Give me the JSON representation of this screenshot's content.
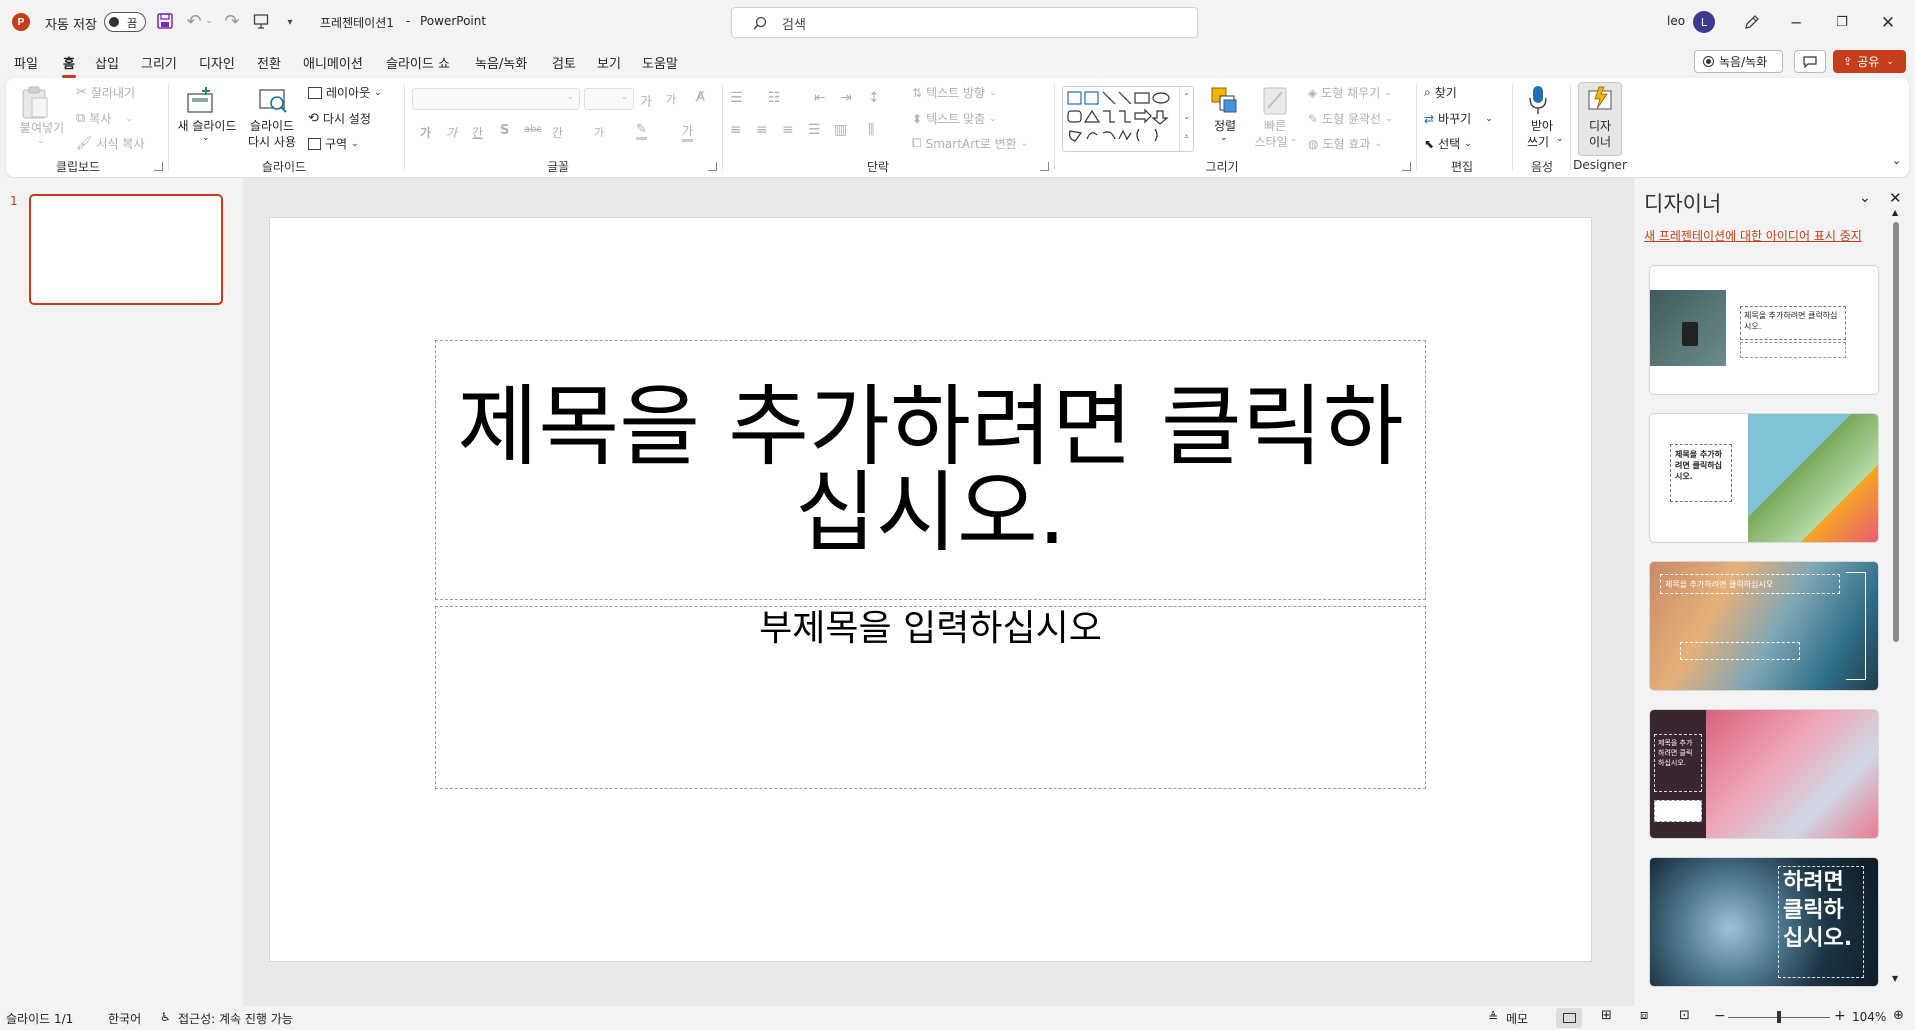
{
  "titlebar": {
    "autosave_label": "자동 저장",
    "autosave_state": "끔",
    "doc_title": "프레젠테이션1",
    "separator": "-",
    "app_name": "PowerPoint",
    "search_placeholder": "검색",
    "user_name": "leo",
    "avatar_initial": "L"
  },
  "tabs": [
    "파일",
    "홈",
    "삽입",
    "그리기",
    "디자인",
    "전환",
    "애니메이션",
    "슬라이드 쇼",
    "녹음/녹화",
    "검토",
    "보기",
    "도움말"
  ],
  "active_tab": "홈",
  "top_right": {
    "record_label": "녹음/녹화",
    "share_label": "공유"
  },
  "ribbon": {
    "clipboard": {
      "paste": "붙여넣기",
      "cut": "잘라내기",
      "copy": "복사",
      "format_painter": "서식 복사",
      "group": "클립보드"
    },
    "slides": {
      "new_slide": "새 슬라이드",
      "reuse_line1": "슬라이드",
      "reuse_line2": "다시 사용",
      "layout": "레이아웃",
      "reset": "다시 설정",
      "section": "구역",
      "group": "슬라이드"
    },
    "font": {
      "group": "글꼴",
      "grow": "가",
      "shrink": "가",
      "b": "가",
      "i": "가",
      "u": "간",
      "s": "S",
      "strike": "abc",
      "spacing": "간",
      "case": "가",
      "highlight": "가"
    },
    "paragraph": {
      "text_direction": "텍스트 방향",
      "align_text": "텍스트 맞춤",
      "smartart": "SmartArt로 변환",
      "group": "단락"
    },
    "drawing": {
      "arrange": "정렬",
      "quick_styles_line1": "빠른",
      "quick_styles_line2": "스타일",
      "fill": "도형 채우기",
      "outline": "도형 윤곽선",
      "effects": "도형 효과",
      "group": "그리기"
    },
    "editing": {
      "find": "찾기",
      "replace": "바꾸기",
      "select": "선택",
      "group": "편집"
    },
    "voice": {
      "dictate_line1": "받아",
      "dictate_line2": "쓰기",
      "group": "음성"
    },
    "designer": {
      "line1": "디자",
      "line2": "이너",
      "group": "Designer"
    }
  },
  "thumbnails": {
    "slide_number": "1"
  },
  "slide": {
    "title_placeholder": "제목을 추가하려면 클릭하십시오.",
    "subtitle_placeholder": "부제목을 입력하십시오"
  },
  "designer": {
    "title": "디자이너",
    "stop_link": "새 프레젠테이션에 대한 아이디어 표시 중지",
    "card1_text": "제목을 추가하려면 클릭하십시오.",
    "card2_text": "제목을 추가하려면 클릭하십시오.",
    "card3_text": "제목을 추가하려면 클릭하십시오",
    "card4_text": "제목을 추가하려면 클릭하십시오.",
    "card5_text": "하려면 클릭하십시오."
  },
  "statusbar": {
    "slide_info": "슬라이드 1/1",
    "language": "한국어",
    "accessibility": "접근성: 계속 진행 가능",
    "notes": "메모",
    "zoom": "104%"
  },
  "colors": {
    "accent": "#c43e1c",
    "share_bg": "#c43e1c",
    "avatar_bg": "#3b3a8c",
    "link": "#c43e1c"
  }
}
